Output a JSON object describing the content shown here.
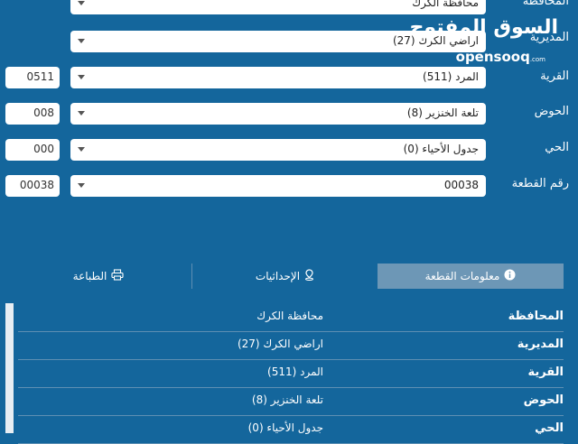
{
  "logo": {
    "arabic": "السوق المفتوح",
    "english": "opensooq",
    "suffix": ".com"
  },
  "form": {
    "fields": [
      {
        "label": "المحافظة",
        "value": "محافظة الكرك",
        "code": ""
      },
      {
        "label": "المديرية",
        "value": "اراضي الكرك (27)",
        "code": ""
      },
      {
        "label": "القرية",
        "value": "المرد (511)",
        "code": "0511"
      },
      {
        "label": "الحوض",
        "value": "تلعة الخنزير (8)",
        "code": "008"
      },
      {
        "label": "الحي",
        "value": "جدول الأحياء (0)",
        "code": "000"
      },
      {
        "label": "رقم القطعة",
        "value": "00038",
        "code": "00038"
      }
    ]
  },
  "tabs": [
    {
      "label": "معلومات القطعة",
      "icon": "info-icon",
      "active": true
    },
    {
      "label": "الإحداثيات",
      "icon": "location-pin-icon",
      "active": false
    },
    {
      "label": "الطباعة",
      "icon": "printer-icon",
      "active": false
    }
  ],
  "details": {
    "rows": [
      {
        "key": "المحافظة",
        "value": "محافظة الكرك"
      },
      {
        "key": "المديرية",
        "value": "اراضي الكرك (27)"
      },
      {
        "key": "القرية",
        "value": "المرد (511)"
      },
      {
        "key": "الحوض",
        "value": "تلعة الخنزير (8)"
      },
      {
        "key": "الحي",
        "value": "جدول الأحياء (0)"
      }
    ]
  },
  "colors": {
    "background": "#14669c",
    "active_tab": "#6d97b6",
    "input": "#ffffff"
  }
}
